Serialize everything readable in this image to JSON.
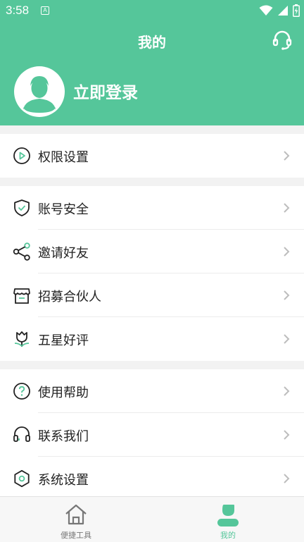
{
  "status": {
    "time": "3:58",
    "a_badge": "A"
  },
  "header": {
    "title": "我的",
    "login_text": "立即登录"
  },
  "groups": [
    [
      {
        "label": "权限设置",
        "icon": "play-circle-icon"
      }
    ],
    [
      {
        "label": "账号安全",
        "icon": "shield-icon"
      },
      {
        "label": "邀请好友",
        "icon": "share-icon"
      },
      {
        "label": "招募合伙人",
        "icon": "store-icon"
      },
      {
        "label": "五星好评",
        "icon": "tulip-icon"
      }
    ],
    [
      {
        "label": "使用帮助",
        "icon": "help-icon"
      },
      {
        "label": "联系我们",
        "icon": "headset-icon"
      },
      {
        "label": "系统设置",
        "icon": "settings-icon"
      }
    ]
  ],
  "tabs": [
    {
      "label": "便捷工具",
      "icon": "home-icon",
      "active": false
    },
    {
      "label": "我的",
      "icon": "user-icon",
      "active": true
    }
  ],
  "colors": {
    "brand": "#55c69a",
    "text": "#222222",
    "inactive": "#777777"
  }
}
